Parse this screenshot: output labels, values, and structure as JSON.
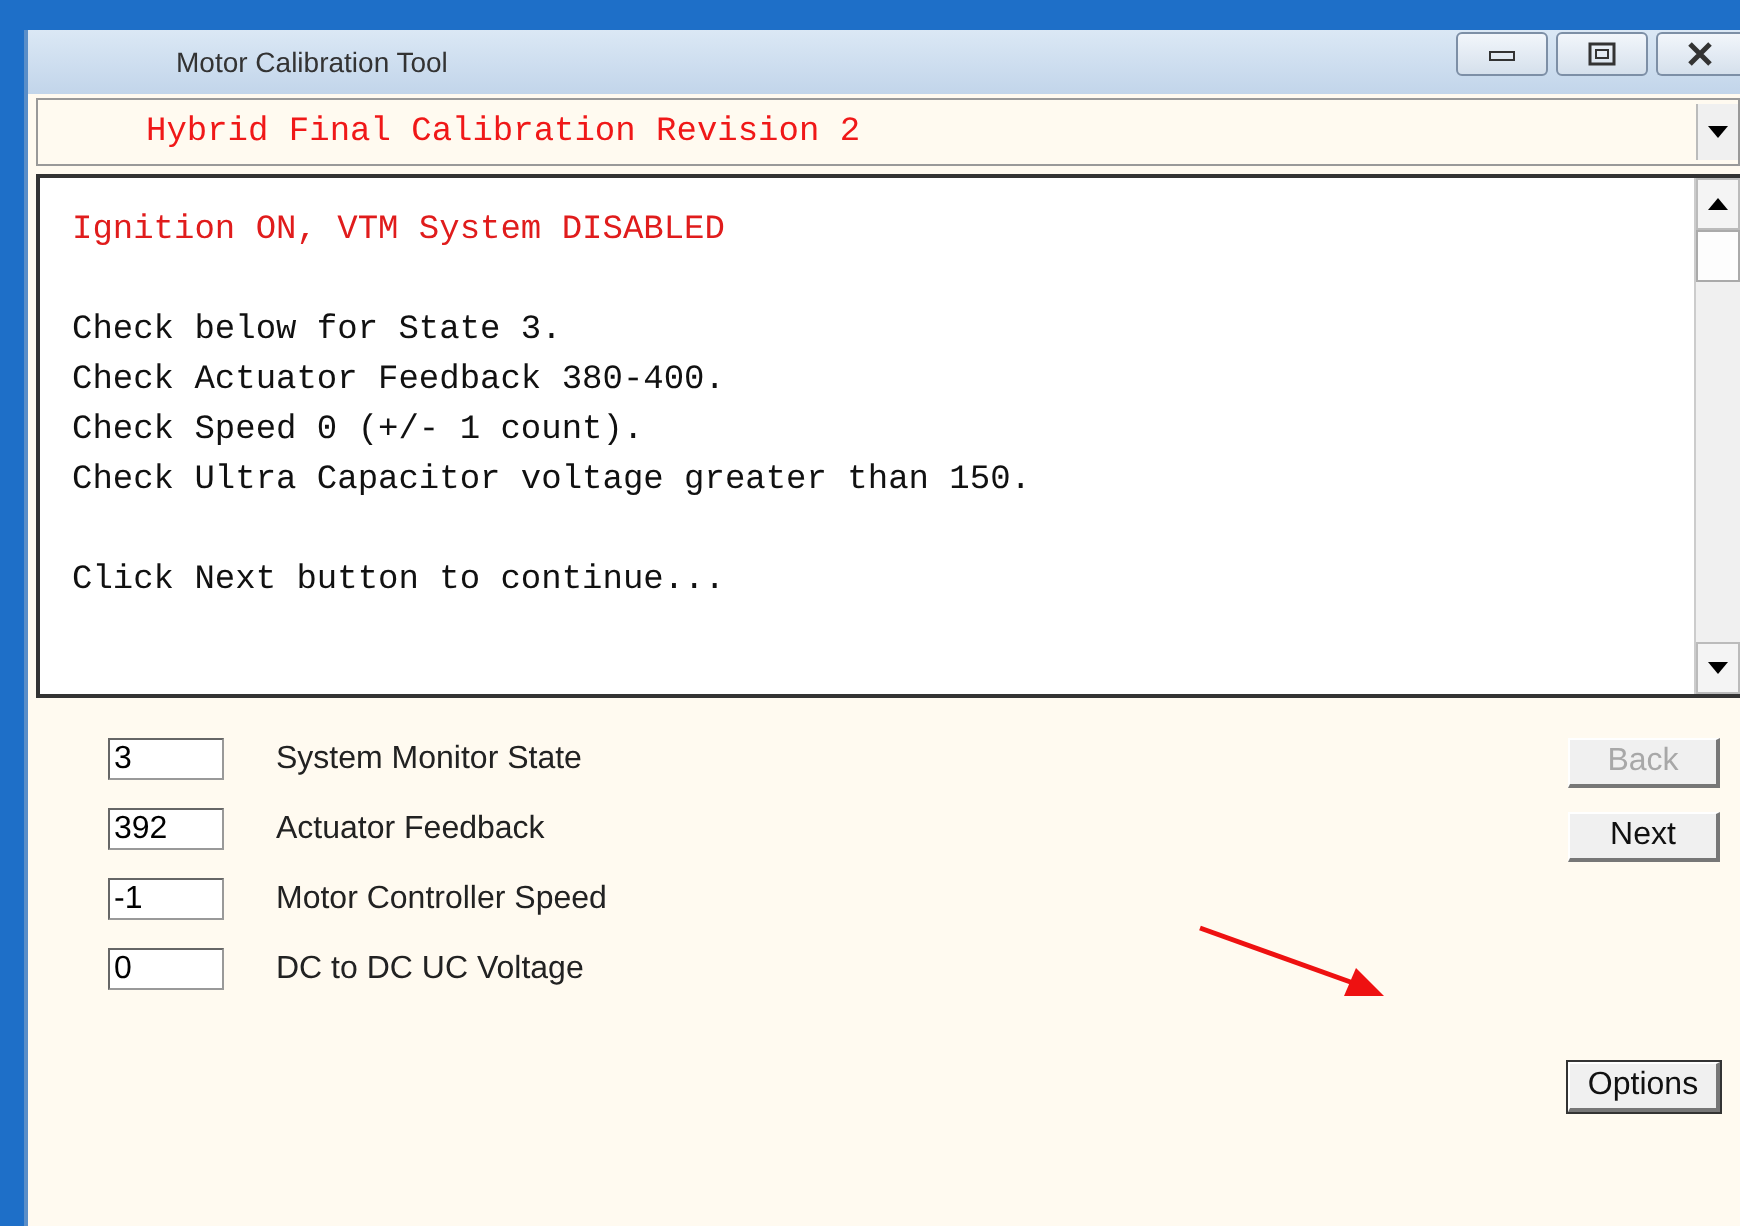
{
  "window": {
    "title": "Motor Calibration Tool"
  },
  "procedure_dropdown": {
    "value": "Hybrid Final Calibration Revision 2"
  },
  "message_paragraphs": [
    {
      "kind": "alert",
      "lines": [
        "Ignition ON, VTM System DISABLED"
      ]
    },
    {
      "kind": "normal",
      "lines": [
        "Check below for State 3.",
        "Check Actuator Feedback 380-400.",
        "Check Speed 0 (+/- 1 count).",
        "Check Ultra Capacitor voltage greater than 150."
      ]
    },
    {
      "kind": "normal",
      "lines": [
        "Click Next button to continue..."
      ]
    }
  ],
  "readings": [
    {
      "value": "3",
      "label": "System Monitor State"
    },
    {
      "value": "392",
      "label": "Actuator Feedback"
    },
    {
      "value": "-1",
      "label": "Motor Controller Speed"
    },
    {
      "value": "0",
      "label": "DC to DC UC Voltage"
    }
  ],
  "buttons": [
    {
      "label": "Back",
      "disabled": true
    },
    {
      "label": "Next",
      "disabled": false
    },
    {
      "label": "Options",
      "disabled": false
    }
  ]
}
